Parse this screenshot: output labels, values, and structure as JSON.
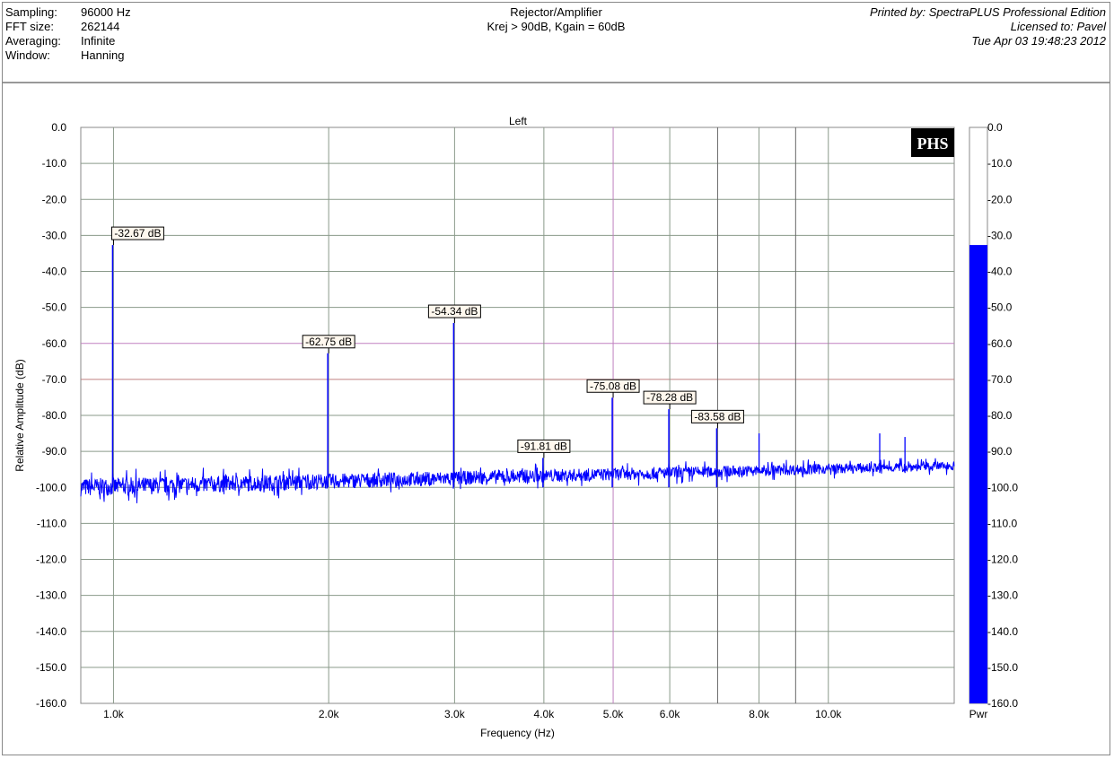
{
  "header": {
    "info": [
      {
        "label": "Sampling:",
        "value": "96000 Hz"
      },
      {
        "label": "FFT size:",
        "value": "262144"
      },
      {
        "label": "Averaging:",
        "value": "Infinite"
      },
      {
        "label": "Window:",
        "value": "Hanning"
      }
    ],
    "title": "Rejector/Amplifier",
    "subtitle": "Krej > 90dB, Kgain = 60dB",
    "printed_by": "Printed by: SpectraPLUS Professional Edition",
    "licensed_to": "Licensed to: Pavel",
    "date": "Tue Apr 03 19:48:23 2012"
  },
  "logo": "PHS",
  "chart_data": {
    "type": "line",
    "title": "Left",
    "xlabel": "Frequency (Hz)",
    "ylabel": "Relative Amplitude (dB)",
    "xscale": "log",
    "xlim": [
      900,
      15000
    ],
    "ylim": [
      -160,
      0
    ],
    "xticks": [
      {
        "v": 1000,
        "l": "1.0k"
      },
      {
        "v": 2000,
        "l": "2.0k"
      },
      {
        "v": 3000,
        "l": "3.0k"
      },
      {
        "v": 4000,
        "l": "4.0k"
      },
      {
        "v": 5000,
        "l": "5.0k"
      },
      {
        "v": 6000,
        "l": "6.0k"
      },
      {
        "v": 8000,
        "l": "8.0k"
      },
      {
        "v": 10000,
        "l": "10.0k"
      }
    ],
    "xgrid": [
      1000,
      2000,
      3000,
      4000,
      5000,
      6000,
      7000,
      8000,
      9000,
      10000
    ],
    "yticks": [
      "0.0",
      "-10.0",
      "-20.0",
      "-30.0",
      "-40.0",
      "-50.0",
      "-60.0",
      "-70.0",
      "-80.0",
      "-90.0",
      "-100.0",
      "-110.0",
      "-120.0",
      "-130.0",
      "-140.0",
      "-150.0",
      "-160.0"
    ],
    "series_color": "#0000ff",
    "noise_floor_db": {
      "start": -100,
      "end": -94
    },
    "peaks": [
      {
        "freq": 1000,
        "db": -32.67,
        "label": "-32.67 dB"
      },
      {
        "freq": 2000,
        "db": -62.75,
        "label": "-62.75 dB"
      },
      {
        "freq": 3000,
        "db": -54.34,
        "label": "-54.34 dB"
      },
      {
        "freq": 4000,
        "db": -91.81,
        "label": "-91.81 dB"
      },
      {
        "freq": 5000,
        "db": -75.08,
        "label": "-75.08 dB"
      },
      {
        "freq": 6000,
        "db": -78.28,
        "label": "-78.28 dB"
      },
      {
        "freq": 7000,
        "db": -83.58,
        "label": "-83.58 dB"
      }
    ],
    "spurs": [
      {
        "freq": 8000,
        "db": -85
      },
      {
        "freq": 11800,
        "db": -85
      },
      {
        "freq": 12800,
        "db": -86
      }
    ],
    "level_meter": {
      "label": "Pwr",
      "value_db": -32.67,
      "ticks": [
        "0.0",
        "-10.0",
        "-20.0",
        "-30.0",
        "-40.0",
        "-50.0",
        "-60.0",
        "-70.0",
        "-80.0",
        "-90.0",
        "-100.0",
        "-110.0",
        "-120.0",
        "-130.0",
        "-140.0",
        "-150.0",
        "-160.0"
      ]
    }
  }
}
